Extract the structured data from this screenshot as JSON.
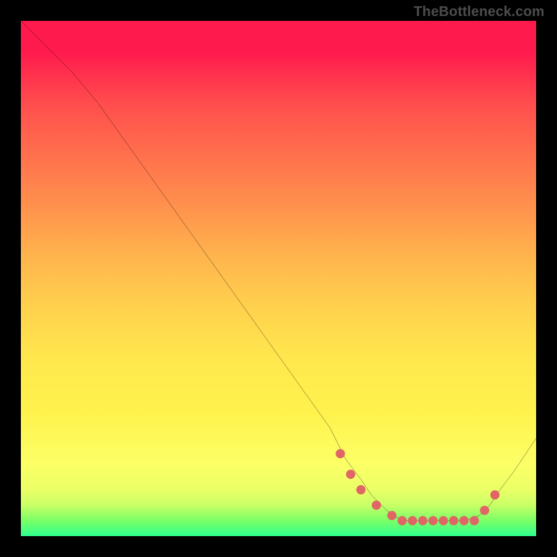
{
  "attribution": "TheBottleneck.com",
  "colors": {
    "line": "#000000",
    "marker": "#e06666",
    "background": "#000000"
  },
  "chart_data": {
    "type": "line",
    "title": "",
    "xlabel": "",
    "ylabel": "",
    "xlim": [
      0,
      100
    ],
    "ylim": [
      0,
      100
    ],
    "grid": false,
    "legend": false,
    "series": [
      {
        "name": "curve",
        "x": [
          0,
          5,
          10,
          15,
          20,
          25,
          30,
          35,
          40,
          45,
          50,
          55,
          60,
          63,
          66,
          68,
          71,
          74,
          77,
          80,
          83,
          86,
          89,
          91,
          93,
          96,
          100
        ],
        "y": [
          100,
          95,
          90,
          84,
          77,
          70,
          63,
          56,
          49,
          42,
          35,
          28,
          21,
          15,
          11,
          8,
          5,
          3,
          3,
          3,
          3,
          3,
          4,
          6,
          9,
          13,
          19
        ]
      }
    ],
    "markers": {
      "name": "points",
      "x": [
        62,
        64,
        66,
        69,
        72,
        74,
        76,
        78,
        80,
        82,
        84,
        86,
        88,
        90,
        92
      ],
      "y": [
        16,
        12,
        9,
        6,
        4,
        3,
        3,
        3,
        3,
        3,
        3,
        3,
        3,
        5,
        8
      ]
    }
  }
}
